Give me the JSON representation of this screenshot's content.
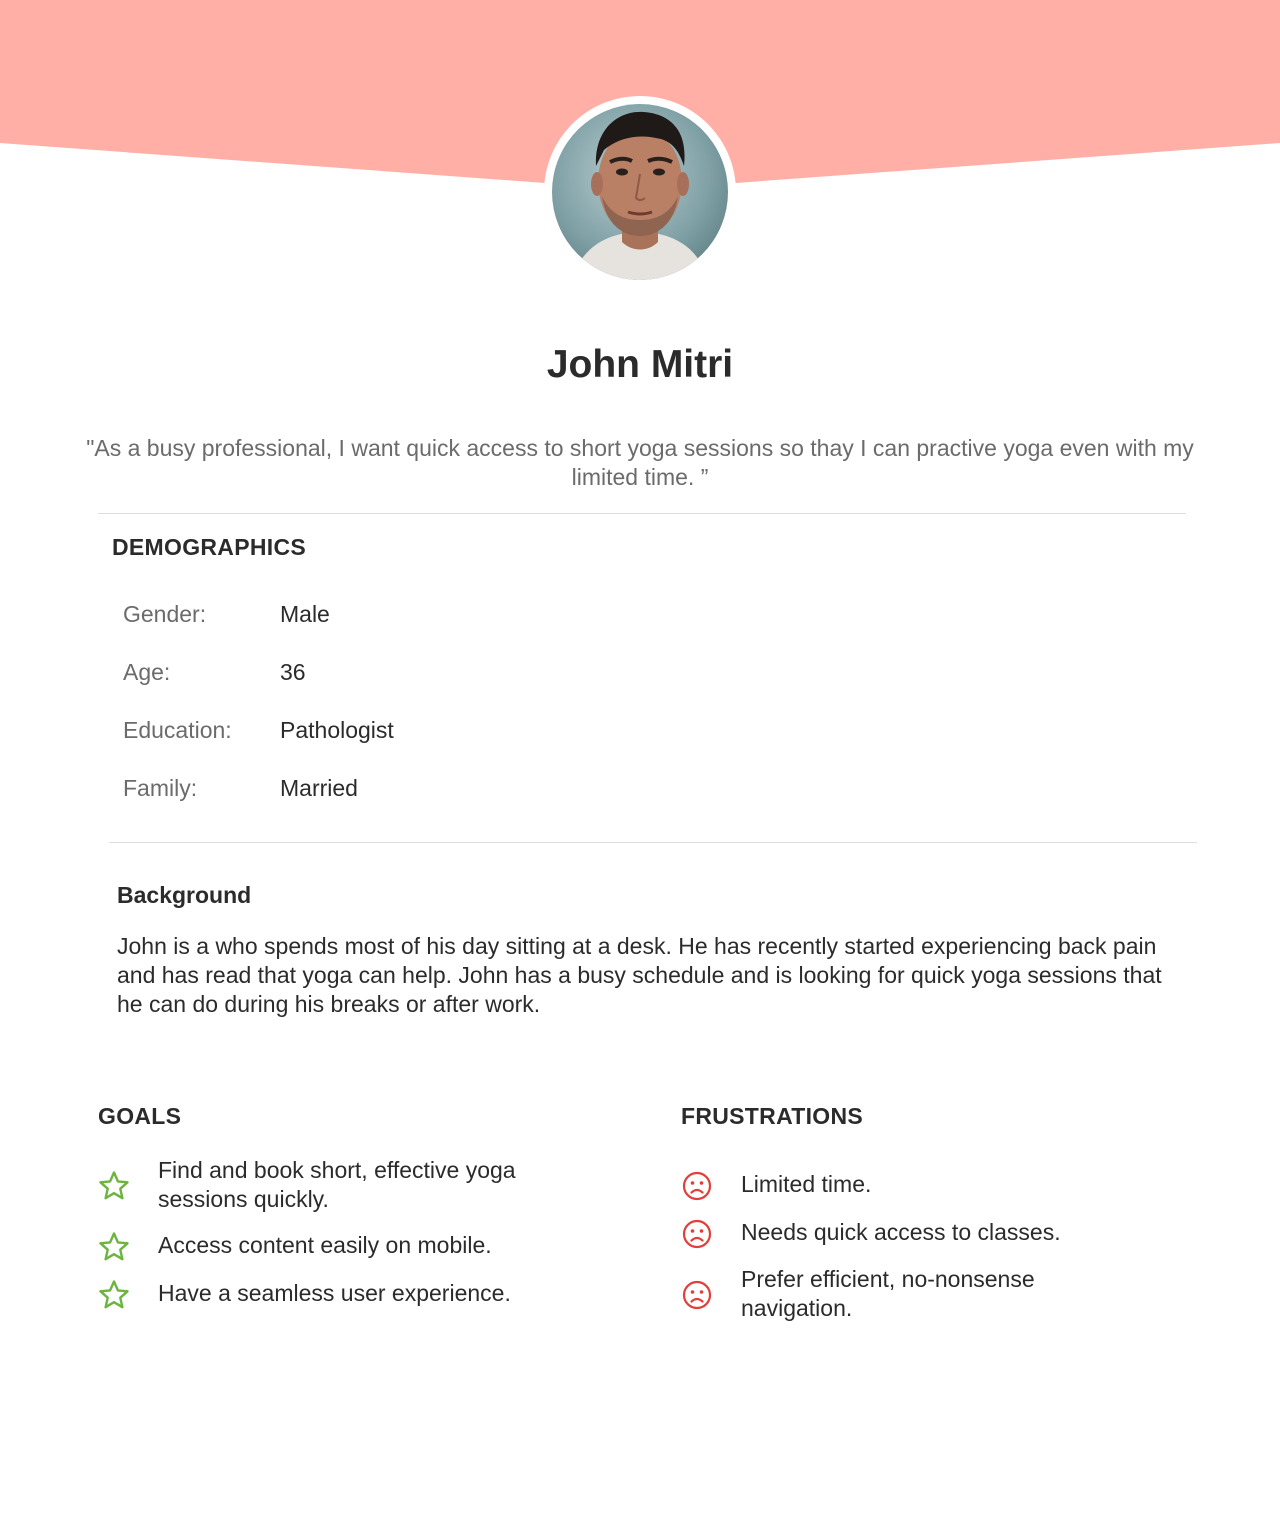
{
  "persona": {
    "name": "John Mitri",
    "quote": "\"As a busy professional, I want quick access to short yoga sessions so thay I can practive yoga even with my limited time. ”"
  },
  "demographics": {
    "title": "DEMOGRAPHICS",
    "rows": [
      {
        "label": "Gender:",
        "value": "Male"
      },
      {
        "label": "Age:",
        "value": "36"
      },
      {
        "label": "Education:",
        "value": "Pathologist"
      },
      {
        "label": "Family:",
        "value": "Married"
      }
    ]
  },
  "background": {
    "title": "Background",
    "text": "John is a  who spends most of his day sitting at a desk. He has recently started experiencing back pain and has read that yoga can help. John has a busy schedule and is looking for quick yoga sessions that he can do during his breaks or after work."
  },
  "goals": {
    "title": "GOALS",
    "items": [
      "Find and book short, effective yoga sessions quickly.",
      "Access content easily on mobile.",
      "Have a seamless user experience."
    ]
  },
  "frustrations": {
    "title": "FRUSTRATIONS",
    "items": [
      "Limited time.",
      "Needs quick access to classes.",
      "Prefer efficient, no-nonsense navigation."
    ]
  },
  "colors": {
    "accent": "#ffafa5",
    "goal_icon": "#6db33f",
    "frustration_icon": "#e0403a",
    "text": "#2b2b2b",
    "muted": "#6b6b6b"
  },
  "icons": {
    "goal": "star-outline-icon",
    "frustration": "sad-face-icon"
  }
}
